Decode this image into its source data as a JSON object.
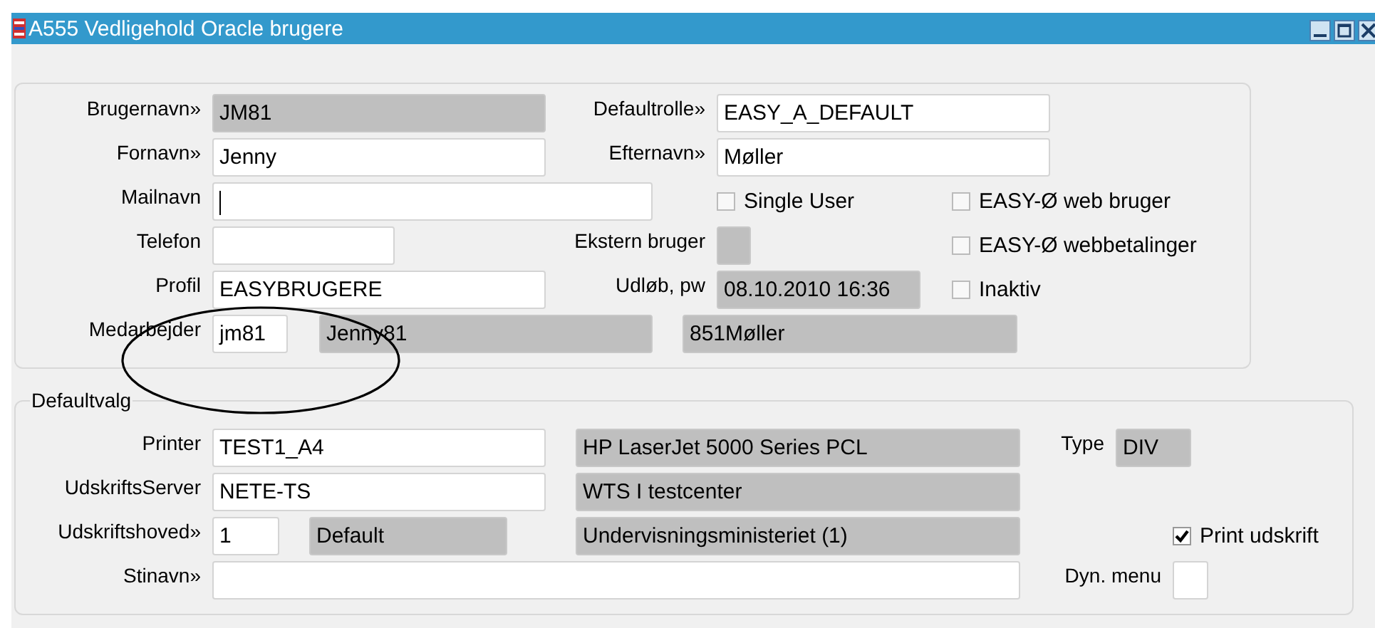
{
  "window": {
    "title": "A555 Vedligehold Oracle brugere"
  },
  "user_panel": {
    "items": [
      {
        "kind": "field",
        "label": "Brugernavn»",
        "value": "JM81",
        "readonly": true
      },
      {
        "kind": "field",
        "label": "Defaultrolle»",
        "value": "EASY_A_DEFAULT",
        "readonly": false
      },
      {
        "kind": "field",
        "label": "Fornavn»",
        "value": "Jenny",
        "readonly": false
      },
      {
        "kind": "field",
        "label": "Efternavn»",
        "value": "Møller",
        "readonly": false
      },
      {
        "kind": "field",
        "label": "Mailnavn",
        "readonly": false,
        "focused": true
      },
      {
        "kind": "checkbox",
        "label": "Single User",
        "checked": false
      },
      {
        "kind": "checkbox",
        "label": "EASY-Ø web bruger",
        "checked": false
      },
      {
        "kind": "field",
        "label": "Telefon",
        "readonly": false
      },
      {
        "kind": "field",
        "label": "Ekstern bruger",
        "readonly": true
      },
      {
        "kind": "checkbox",
        "label": "EASY-Ø webbetalinger",
        "checked": false
      },
      {
        "kind": "field",
        "label": "Profil",
        "value": "EASYBRUGERE",
        "readonly": false
      },
      {
        "kind": "field",
        "label": "Udløb, pw",
        "value": "08.10.2010 16:36",
        "readonly": true
      },
      {
        "kind": "checkbox",
        "label": "Inaktiv",
        "checked": false
      },
      {
        "kind": "field",
        "label": "Medarbejder",
        "value": "jm81",
        "readonly": false
      },
      {
        "kind": "field",
        "value": "Jenny81",
        "readonly": true
      },
      {
        "kind": "field",
        "value": "851Møller",
        "readonly": true
      }
    ]
  },
  "default_panel": {
    "title": "Defaultvalg",
    "items": [
      {
        "kind": "field",
        "label": "Printer",
        "value": "TEST1_A4",
        "readonly": false
      },
      {
        "kind": "field",
        "value": "HP LaserJet 5000 Series PCL",
        "readonly": true
      },
      {
        "kind": "field",
        "label": "Type",
        "value": "DIV",
        "readonly": true
      },
      {
        "kind": "field",
        "label": "UdskriftsServer",
        "value": "NETE-TS",
        "readonly": false
      },
      {
        "kind": "field",
        "value": "WTS I testcenter",
        "readonly": true
      },
      {
        "kind": "field",
        "label": "Udskriftshoved»",
        "value": "1",
        "readonly": false
      },
      {
        "kind": "field",
        "value": "Default",
        "readonly": true
      },
      {
        "kind": "field",
        "value": "Undervisningsministeriet (1)",
        "readonly": true
      },
      {
        "kind": "checkbox",
        "label": "Print udskrift",
        "checked": true
      },
      {
        "kind": "field",
        "label": "Stinavn»",
        "readonly": false
      },
      {
        "kind": "field",
        "label": "Dyn. menu",
        "readonly": false
      }
    ]
  },
  "annotation": {
    "kind": "ellipse"
  }
}
